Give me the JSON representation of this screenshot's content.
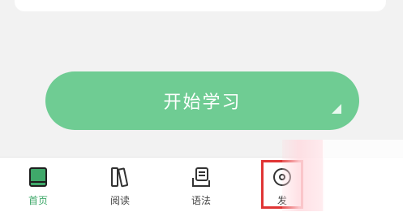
{
  "main": {
    "start_button_label": "开始学习"
  },
  "tabbar": {
    "items": [
      {
        "label": "首页",
        "icon": "book-icon",
        "active": true
      },
      {
        "label": "阅读",
        "icon": "books-icon",
        "active": false
      },
      {
        "label": "语法",
        "icon": "document-icon",
        "active": false
      },
      {
        "label": "发",
        "icon": "discover-icon",
        "active": false
      }
    ]
  },
  "colors": {
    "accent": "#6fcc93",
    "active_tab": "#3fa86a",
    "highlight_box": "#e03434"
  }
}
